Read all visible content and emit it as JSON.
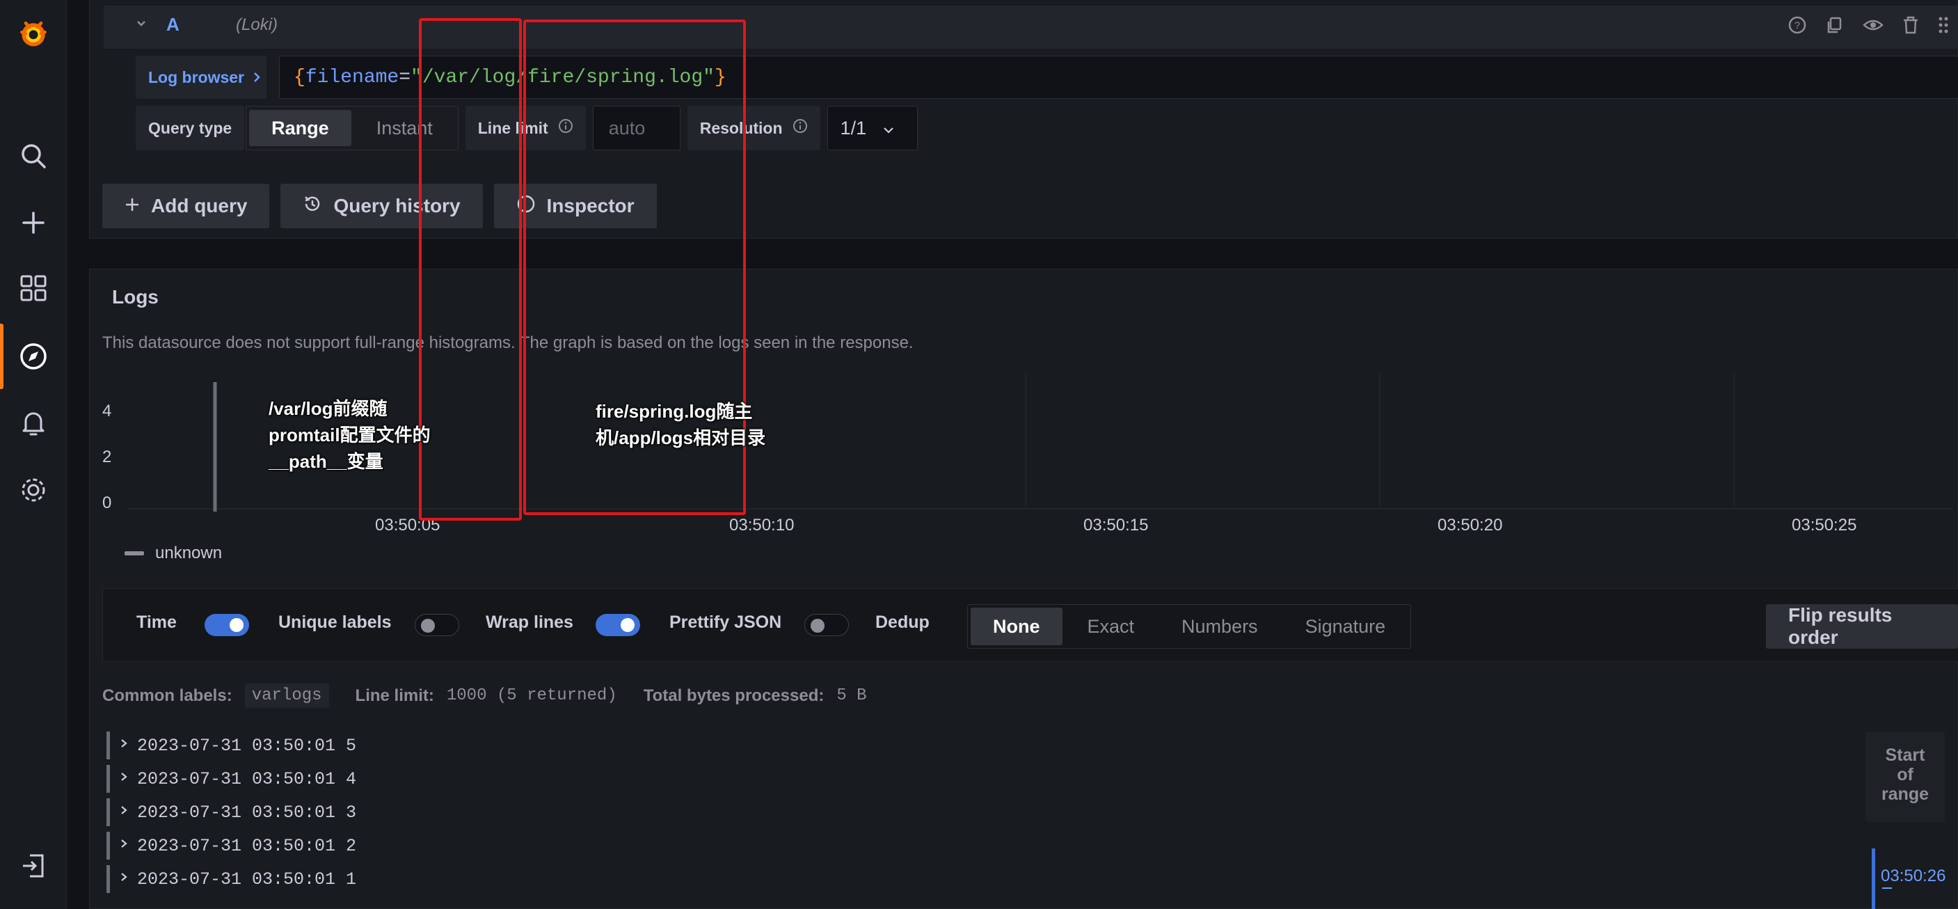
{
  "query": {
    "ref_id": "A",
    "datasource": "(Loki)",
    "log_browser_label": "Log browser",
    "expr": {
      "open_brace": "{",
      "label": "filename",
      "eq": "=",
      "value": "\"/var/log/fire/spring.log\"",
      "close_brace": "}"
    },
    "query_type_label": "Query type",
    "query_types": [
      "Range",
      "Instant"
    ],
    "line_limit_label": "Line limit",
    "line_limit_placeholder": "auto",
    "resolution_label": "Resolution",
    "resolution_value": "1/1"
  },
  "actions": {
    "add_query": "Add query",
    "query_history": "Query history",
    "inspector": "Inspector"
  },
  "logs": {
    "title": "Logs",
    "info": "This datasource does not support full-range histograms. The graph is based on the logs seen in the response.",
    "legend": "unknown",
    "options": {
      "time": "Time",
      "unique_labels": "Unique labels",
      "wrap_lines": "Wrap lines",
      "prettify_json": "Prettify JSON",
      "dedup": "Dedup",
      "dedup_modes": [
        "None",
        "Exact",
        "Numbers",
        "Signature"
      ],
      "flip": "Flip results order"
    },
    "meta": {
      "common_labels_label": "Common labels:",
      "common_labels_value": "varlogs",
      "line_limit_label": "Line limit:",
      "line_limit_value": "1000 (5 returned)",
      "bytes_label": "Total bytes processed:",
      "bytes_value": "5 B"
    },
    "rows": [
      "2023-07-31 03:50:01 5",
      "2023-07-31 03:50:01 4",
      "2023-07-31 03:50:01 3",
      "2023-07-31 03:50:01 2",
      "2023-07-31 03:50:01 1"
    ],
    "range_label": "Start of range",
    "range_time": "03:50:26"
  },
  "chart_data": {
    "type": "bar",
    "y_ticks": [
      "4",
      "2",
      "0"
    ],
    "x_ticks": [
      "03:50:05",
      "03:50:10",
      "03:50:15",
      "03:50:20",
      "03:50:25"
    ],
    "series": [
      {
        "name": "unknown",
        "values": []
      }
    ]
  },
  "annotations": {
    "left_1": "/var/log前缀随",
    "left_2": "promtail配置文件的",
    "left_3": "__path__变量",
    "right_1": "fire/spring.log随主",
    "right_2": "机/app/logs相对目录"
  },
  "colors": {
    "accent_blue": "#3d71d9",
    "brand_orange": "#ff7a1a",
    "annotation_red": "#e0171c"
  }
}
